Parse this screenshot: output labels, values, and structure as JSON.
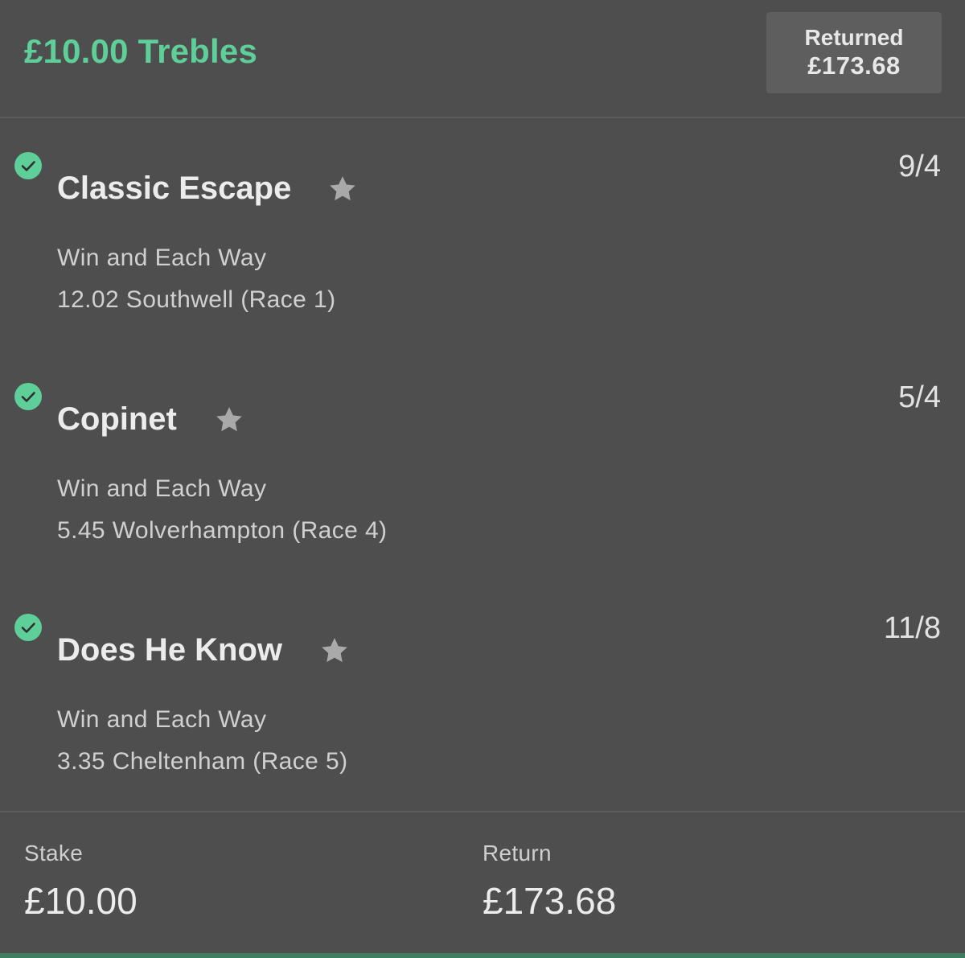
{
  "bet": {
    "title": "£10.00 Trebles",
    "returned_label": "Returned",
    "returned_amount": "£173.68"
  },
  "selections": [
    {
      "name": "Classic Escape",
      "market": "Win and Each Way",
      "event": "12.02 Southwell (Race 1)",
      "odds": "9/4",
      "status": "won"
    },
    {
      "name": "Copinet",
      "market": "Win and Each Way",
      "event": "5.45 Wolverhampton (Race 4)",
      "odds": "5/4",
      "status": "won"
    },
    {
      "name": "Does He Know",
      "market": "Win and Each Way",
      "event": "3.35 Cheltenham (Race 5)",
      "odds": "11/8",
      "status": "won"
    }
  ],
  "footer": {
    "stake_label": "Stake",
    "stake_value": "£10.00",
    "return_label": "Return",
    "return_value": "£173.68"
  },
  "icons": {
    "status_won": "check-circle-icon",
    "favourite": "star-icon"
  },
  "colors": {
    "background": "#4e4e4e",
    "accent_green": "#5fcf9a",
    "returned_box": "#5e5e5e",
    "star_grey": "#a9a9a9"
  }
}
